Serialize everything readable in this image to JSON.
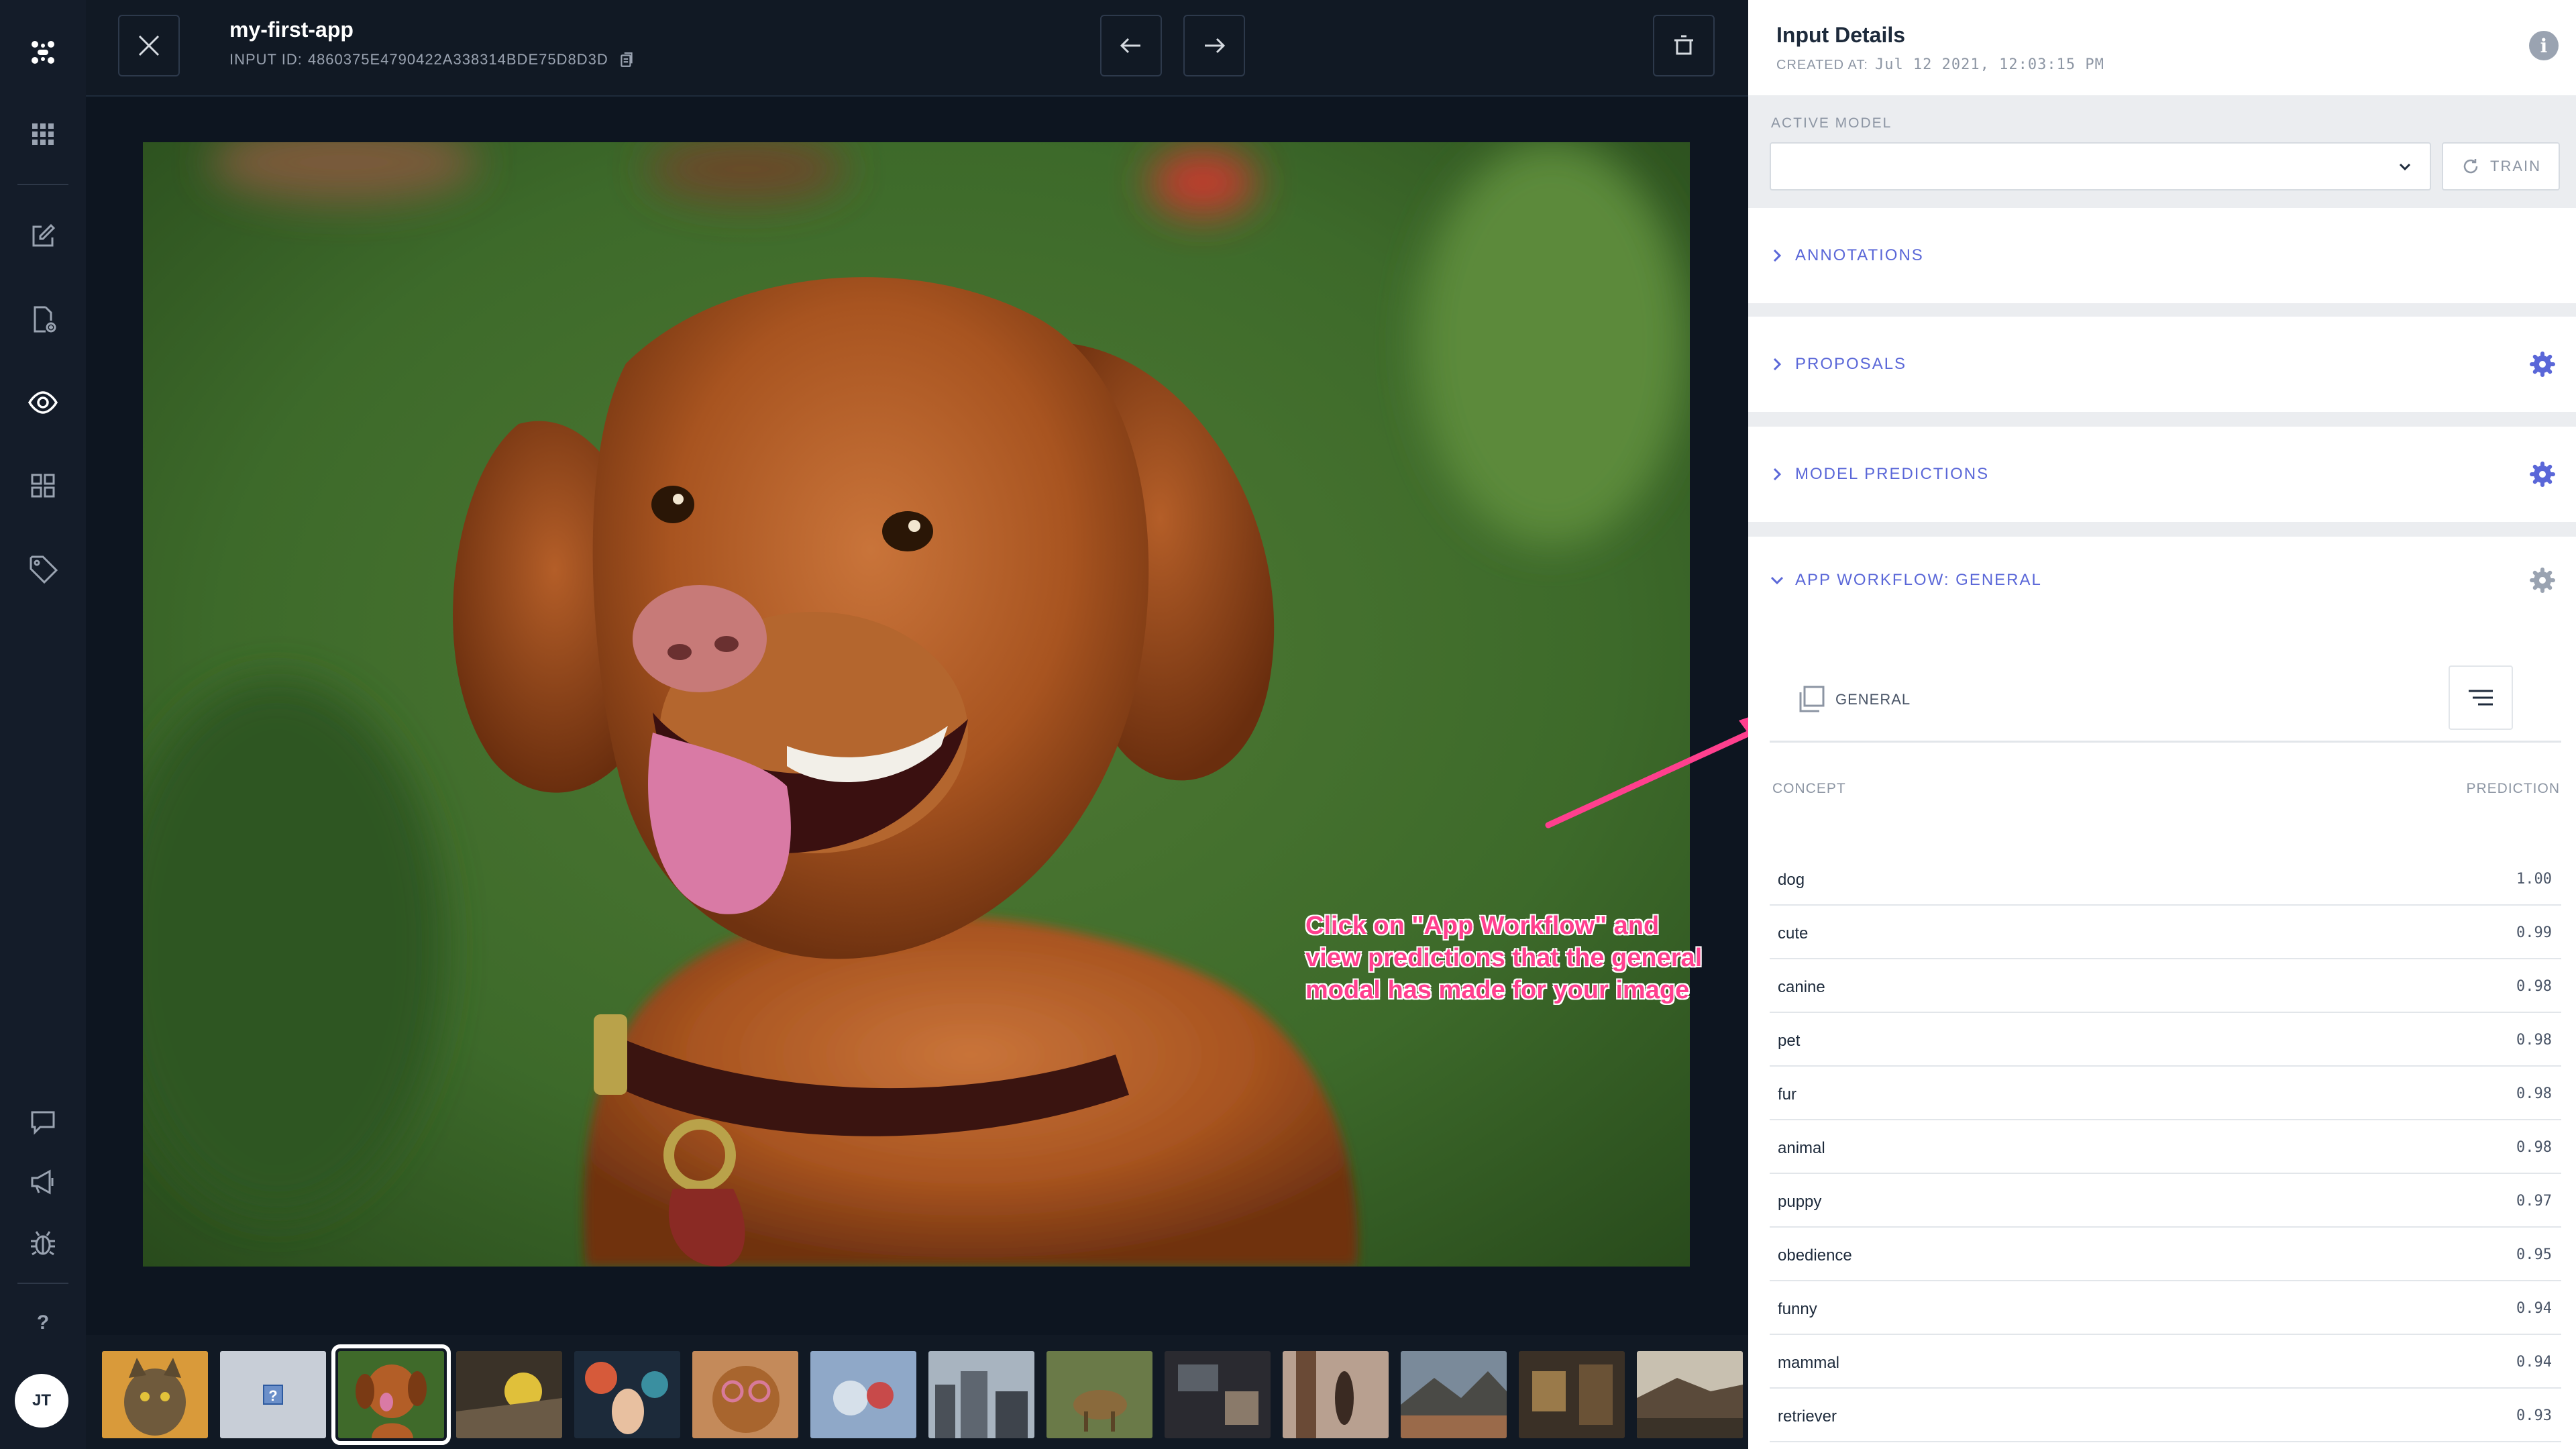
{
  "app": {
    "title": "my-first-app",
    "input_id_label": "INPUT ID:",
    "input_id": "4860375E4790422A338314BDE75D8D3D"
  },
  "nav": {
    "items": [
      "logo-icon",
      "apps-grid-icon",
      "edit-icon",
      "add-file-icon",
      "eye-icon",
      "grid-icon",
      "tag-icon",
      "chat-icon",
      "megaphone-icon",
      "bug-icon",
      "help-icon"
    ],
    "help_label": "?",
    "avatar_initials": "JT"
  },
  "panel": {
    "title": "Input Details",
    "created_label": "CREATED AT:",
    "created_value": "Jul 12 2021, 12:03:15 PM",
    "active_model_label": "ACTIVE MODEL",
    "active_model_value": "",
    "train_label": "TRAIN",
    "sections": {
      "annotations": "ANNOTATIONS",
      "proposals": "PROPOSALS",
      "model_predictions": "MODEL PREDICTIONS",
      "app_workflow": "APP WORKFLOW: GENERAL"
    },
    "workflow": {
      "model_label": "GENERAL",
      "col_concept": "CONCEPT",
      "col_prediction": "PREDICTION",
      "predictions": [
        {
          "concept": "dog",
          "value": "1.00"
        },
        {
          "concept": "cute",
          "value": "0.99"
        },
        {
          "concept": "canine",
          "value": "0.98"
        },
        {
          "concept": "pet",
          "value": "0.98"
        },
        {
          "concept": "fur",
          "value": "0.98"
        },
        {
          "concept": "animal",
          "value": "0.98"
        },
        {
          "concept": "puppy",
          "value": "0.97"
        },
        {
          "concept": "obedience",
          "value": "0.95"
        },
        {
          "concept": "funny",
          "value": "0.94"
        },
        {
          "concept": "mammal",
          "value": "0.94"
        },
        {
          "concept": "retriever",
          "value": "0.93"
        }
      ]
    }
  },
  "annotation": {
    "text": "Click on \"App Workflow\" and view predictions that the general modal has made for your image"
  },
  "filmstrip": {
    "count": 14,
    "selected_index": 2
  },
  "colors": {
    "accent": "#5a67d8",
    "annotation": "#ff3f8e",
    "nav_bg": "#141c29",
    "stage_bg": "#0d1520"
  }
}
